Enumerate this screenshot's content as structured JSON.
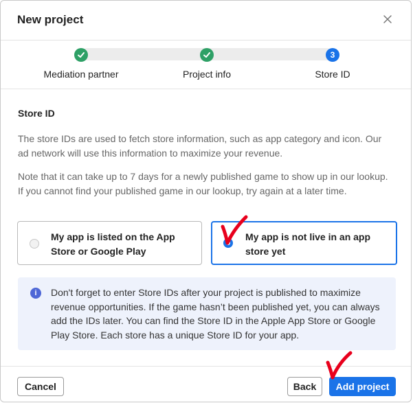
{
  "dialog": {
    "title": "New project",
    "close_icon": "close-icon"
  },
  "steps": [
    {
      "label": "Mediation partner",
      "state": "done",
      "icon": "check-icon"
    },
    {
      "label": "Project info",
      "state": "done",
      "icon": "check-icon"
    },
    {
      "label": "Store ID",
      "state": "current",
      "number": "3"
    }
  ],
  "content": {
    "section_title": "Store ID",
    "paragraph1": "The store IDs are used to fetch store information, such as app category and icon. Our ad network will use this information to maximize your revenue.",
    "paragraph2": "Note that it can take up to 7 days for a newly published game to show up in our lookup. If you cannot find your published game in our lookup, try again at a later time."
  },
  "options": [
    {
      "label": "My app is listed on the App Store or Google Play",
      "selected": false
    },
    {
      "label": "My app is not live in an app store yet",
      "selected": true
    }
  ],
  "info": {
    "icon": "info-icon",
    "icon_glyph": "i",
    "text": "Don't forget to enter Store IDs after your project is published to maximize revenue opportunities. If the game hasn’t been published yet, you can always add the IDs later. You can find the Store ID in the Apple App Store or Google Play Store. Each store has a unique Store ID for your app."
  },
  "footer": {
    "cancel_label": "Cancel",
    "back_label": "Back",
    "add_label": "Add project"
  },
  "colors": {
    "accent": "#1a73e8",
    "step_done": "#2ea066",
    "info_bg": "#eef2fc",
    "annotation_red": "#e8001c"
  }
}
